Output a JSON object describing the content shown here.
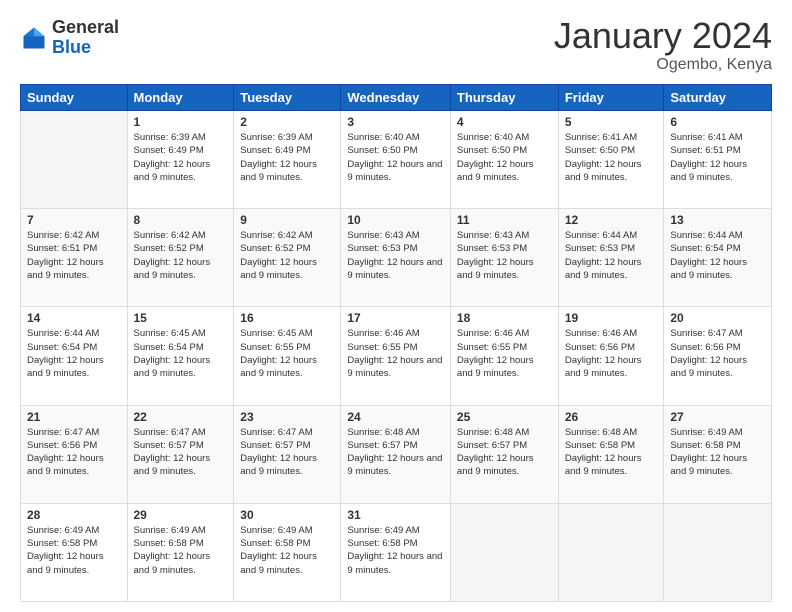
{
  "logo": {
    "general": "General",
    "blue": "Blue"
  },
  "header": {
    "month": "January 2024",
    "location": "Ogembo, Kenya"
  },
  "weekdays": [
    "Sunday",
    "Monday",
    "Tuesday",
    "Wednesday",
    "Thursday",
    "Friday",
    "Saturday"
  ],
  "weeks": [
    [
      {
        "day": "",
        "empty": true
      },
      {
        "day": "1",
        "sunrise": "6:39 AM",
        "sunset": "6:49 PM",
        "daylight": "12 hours and 9 minutes."
      },
      {
        "day": "2",
        "sunrise": "6:39 AM",
        "sunset": "6:49 PM",
        "daylight": "12 hours and 9 minutes."
      },
      {
        "day": "3",
        "sunrise": "6:40 AM",
        "sunset": "6:50 PM",
        "daylight": "12 hours and 9 minutes."
      },
      {
        "day": "4",
        "sunrise": "6:40 AM",
        "sunset": "6:50 PM",
        "daylight": "12 hours and 9 minutes."
      },
      {
        "day": "5",
        "sunrise": "6:41 AM",
        "sunset": "6:50 PM",
        "daylight": "12 hours and 9 minutes."
      },
      {
        "day": "6",
        "sunrise": "6:41 AM",
        "sunset": "6:51 PM",
        "daylight": "12 hours and 9 minutes."
      }
    ],
    [
      {
        "day": "7",
        "sunrise": "6:42 AM",
        "sunset": "6:51 PM",
        "daylight": "12 hours and 9 minutes."
      },
      {
        "day": "8",
        "sunrise": "6:42 AM",
        "sunset": "6:52 PM",
        "daylight": "12 hours and 9 minutes."
      },
      {
        "day": "9",
        "sunrise": "6:42 AM",
        "sunset": "6:52 PM",
        "daylight": "12 hours and 9 minutes."
      },
      {
        "day": "10",
        "sunrise": "6:43 AM",
        "sunset": "6:53 PM",
        "daylight": "12 hours and 9 minutes."
      },
      {
        "day": "11",
        "sunrise": "6:43 AM",
        "sunset": "6:53 PM",
        "daylight": "12 hours and 9 minutes."
      },
      {
        "day": "12",
        "sunrise": "6:44 AM",
        "sunset": "6:53 PM",
        "daylight": "12 hours and 9 minutes."
      },
      {
        "day": "13",
        "sunrise": "6:44 AM",
        "sunset": "6:54 PM",
        "daylight": "12 hours and 9 minutes."
      }
    ],
    [
      {
        "day": "14",
        "sunrise": "6:44 AM",
        "sunset": "6:54 PM",
        "daylight": "12 hours and 9 minutes."
      },
      {
        "day": "15",
        "sunrise": "6:45 AM",
        "sunset": "6:54 PM",
        "daylight": "12 hours and 9 minutes."
      },
      {
        "day": "16",
        "sunrise": "6:45 AM",
        "sunset": "6:55 PM",
        "daylight": "12 hours and 9 minutes."
      },
      {
        "day": "17",
        "sunrise": "6:46 AM",
        "sunset": "6:55 PM",
        "daylight": "12 hours and 9 minutes."
      },
      {
        "day": "18",
        "sunrise": "6:46 AM",
        "sunset": "6:55 PM",
        "daylight": "12 hours and 9 minutes."
      },
      {
        "day": "19",
        "sunrise": "6:46 AM",
        "sunset": "6:56 PM",
        "daylight": "12 hours and 9 minutes."
      },
      {
        "day": "20",
        "sunrise": "6:47 AM",
        "sunset": "6:56 PM",
        "daylight": "12 hours and 9 minutes."
      }
    ],
    [
      {
        "day": "21",
        "sunrise": "6:47 AM",
        "sunset": "6:56 PM",
        "daylight": "12 hours and 9 minutes."
      },
      {
        "day": "22",
        "sunrise": "6:47 AM",
        "sunset": "6:57 PM",
        "daylight": "12 hours and 9 minutes."
      },
      {
        "day": "23",
        "sunrise": "6:47 AM",
        "sunset": "6:57 PM",
        "daylight": "12 hours and 9 minutes."
      },
      {
        "day": "24",
        "sunrise": "6:48 AM",
        "sunset": "6:57 PM",
        "daylight": "12 hours and 9 minutes."
      },
      {
        "day": "25",
        "sunrise": "6:48 AM",
        "sunset": "6:57 PM",
        "daylight": "12 hours and 9 minutes."
      },
      {
        "day": "26",
        "sunrise": "6:48 AM",
        "sunset": "6:58 PM",
        "daylight": "12 hours and 9 minutes."
      },
      {
        "day": "27",
        "sunrise": "6:49 AM",
        "sunset": "6:58 PM",
        "daylight": "12 hours and 9 minutes."
      }
    ],
    [
      {
        "day": "28",
        "sunrise": "6:49 AM",
        "sunset": "6:58 PM",
        "daylight": "12 hours and 9 minutes."
      },
      {
        "day": "29",
        "sunrise": "6:49 AM",
        "sunset": "6:58 PM",
        "daylight": "12 hours and 9 minutes."
      },
      {
        "day": "30",
        "sunrise": "6:49 AM",
        "sunset": "6:58 PM",
        "daylight": "12 hours and 9 minutes."
      },
      {
        "day": "31",
        "sunrise": "6:49 AM",
        "sunset": "6:58 PM",
        "daylight": "12 hours and 9 minutes."
      },
      {
        "day": "",
        "empty": true
      },
      {
        "day": "",
        "empty": true
      },
      {
        "day": "",
        "empty": true
      }
    ]
  ]
}
